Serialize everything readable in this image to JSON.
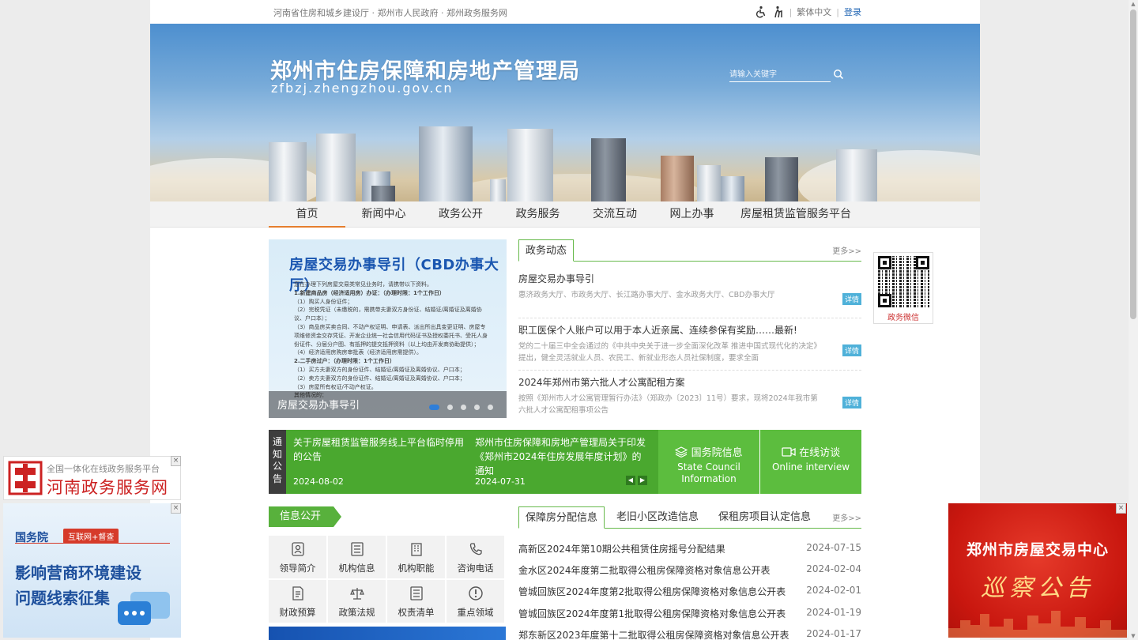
{
  "topbar": {
    "links": "河南省住房和城乡建设厅 · 郑州市人民政府 · 郑州政务服务网",
    "traditional": "繁体中文",
    "login": "登录"
  },
  "banner": {
    "title": "郑州市住房保障和房地产管理局",
    "domain": "zfbzj.zhengzhou.gov.cn",
    "search_placeholder": "请输入关键字"
  },
  "nav": [
    "首页",
    "新闻中心",
    "政务公开",
    "政务服务",
    "交流互动",
    "网上办事",
    "房屋租赁监管服务平台"
  ],
  "slider": {
    "poster_title": "房屋交易办事导引（CBD办事大厅）",
    "poster_lines": [
      "您在办理下列房屋交易类常见业务时，请携带以下资料。",
      "1.新建商品房（经济适用房）办证：（办理时限：1个工作日）",
      "（1）购买人身份证件；",
      "（2）完税凭证（未缴税的，需携带夫妻双方身份证、结婚证/离婚证及离婚协议、户口本）；",
      "（3）商品房买卖合同、不动产权证明、申请表、派出所出具变更证明、房屋专项维修资金交存凭证、开发企业统一社会信用代码证书及授权委托书、受托人身份证件、分层分户图、有抵押的提交抵押资料（以上均由开发商协助提供）；",
      "（4）经济适用房购房审批表（经济适用房需提供）。",
      "2.二手房过户：（办理时限：1个工作日）",
      "（1）买方夫妻双方的身份证件、结婚证/离婚证及离婚协议、户口本；",
      "（2）卖方夫妻双方的身份证件、结婚证/离婚证及离婚协议、户口本；",
      "（3）房屋所有权证/不动产权证。",
      "其他情况的："
    ],
    "caption": "房屋交易办事导引"
  },
  "news": {
    "tab": "政务动态",
    "more": "更多>>",
    "badge": "详情",
    "items": [
      {
        "title": "房屋交易办事导引",
        "desc": "惠济政务大厅、市政务大厅、长江路办事大厅、金水政务大厅、CBD办事大厅"
      },
      {
        "title": "职工医保个人账户可以用于本人近亲属、连续参保有奖励……最新!",
        "desc": "党的二十届三中全会通过的《中共中央关于进一步全面深化改革 推进中国式现代化的决定》提出，健全灵活就业人员、农民工、新就业形态人员社保制度，要求全面"
      },
      {
        "title": "2024年郑州市第六批人才公寓配租方案",
        "desc": "按照《郑州市人才公寓管理暂行办法》（郑政办〔2023〕11号）要求，现将2024年我市第六批人才公寓配租事项公告"
      }
    ]
  },
  "qr": {
    "label": "政务微信"
  },
  "notice": {
    "label": [
      "通",
      "知",
      "公",
      "告"
    ],
    "items": [
      {
        "title": "关于房屋租赁监管服务线上平台临时停用的公告",
        "date": "2024-08-02"
      },
      {
        "title": "郑州市住房保障和房地产管理局关于印发《郑州市2024年住房发展年度计划》的通知",
        "date": "2024-07-31"
      }
    ],
    "state_council": {
      "cn": "国务院信息",
      "en": "State Council Information"
    },
    "online": {
      "cn": "在线访谈",
      "en": "Online interview"
    }
  },
  "info": {
    "title": "信息公开",
    "cells": [
      "领导简介",
      "机构信息",
      "机构职能",
      "咨询电话",
      "财政预算",
      "政策法规",
      "权责清单",
      "重点领域"
    ]
  },
  "housing": {
    "tabs": [
      "保障房分配信息",
      "老旧小区改造信息",
      "保租房项目认定信息"
    ],
    "more": "更多>>",
    "rows": [
      {
        "title": "高新区2024年第10期公共租赁住房摇号分配结果",
        "date": "2024-07-15"
      },
      {
        "title": "金水区2024年度第二批取得公租房保障资格对象信息公开表",
        "date": "2024-02-04"
      },
      {
        "title": "管城回族区2024年度第2批取得公租房保障资格对象信息公开表",
        "date": "2024-02-01"
      },
      {
        "title": "管城回族区2024年度第1批取得公租房保障资格对象信息公开表",
        "date": "2024-01-19"
      },
      {
        "title": "郑东新区2023年度第十二批取得公租房保障资格对象信息公开表",
        "date": "2024-01-17"
      }
    ]
  },
  "float_left1": {
    "line1": "全国一体化在线政务服务平台",
    "line2": "河南政务服务网"
  },
  "float_left2": {
    "brand": "国务院",
    "tag": "互联网+督查",
    "line1": "影响营商环境建设",
    "line2": "问题线索征集"
  },
  "float_right": {
    "line1": "郑州市房屋交易中心",
    "line2": "巡察公告"
  },
  "close": "×"
}
